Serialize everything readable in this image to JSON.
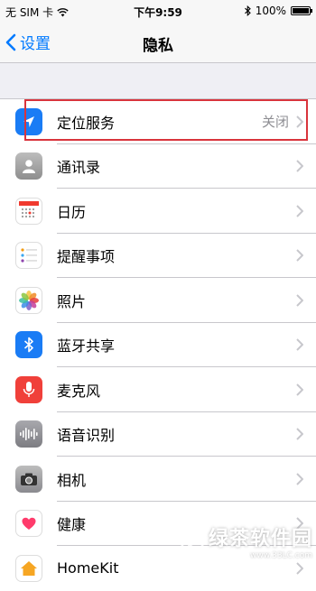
{
  "status_bar": {
    "carrier": "无 SIM 卡",
    "time": "下午9:59",
    "battery": "100%"
  },
  "nav": {
    "back_label": "设置",
    "title": "隐私"
  },
  "rows": [
    {
      "label": "定位服务",
      "value": "关闭",
      "icon": "location-arrow-icon"
    },
    {
      "label": "通讯录",
      "value": "",
      "icon": "contacts-icon"
    },
    {
      "label": "日历",
      "value": "",
      "icon": "calendar-icon"
    },
    {
      "label": "提醒事项",
      "value": "",
      "icon": "reminders-icon"
    },
    {
      "label": "照片",
      "value": "",
      "icon": "photos-icon"
    },
    {
      "label": "蓝牙共享",
      "value": "",
      "icon": "bluetooth-icon"
    },
    {
      "label": "麦克风",
      "value": "",
      "icon": "microphone-icon"
    },
    {
      "label": "语音识别",
      "value": "",
      "icon": "speech-recognition-icon"
    },
    {
      "label": "相机",
      "value": "",
      "icon": "camera-icon"
    },
    {
      "label": "健康",
      "value": "",
      "icon": "health-icon"
    },
    {
      "label": "HomeKit",
      "value": "",
      "icon": "homekit-icon"
    }
  ],
  "colors": {
    "accent": "#007aff",
    "highlight": "#d9343c"
  },
  "watermark": {
    "text": "绿茶软件园",
    "sub": "www.33LC.com"
  }
}
